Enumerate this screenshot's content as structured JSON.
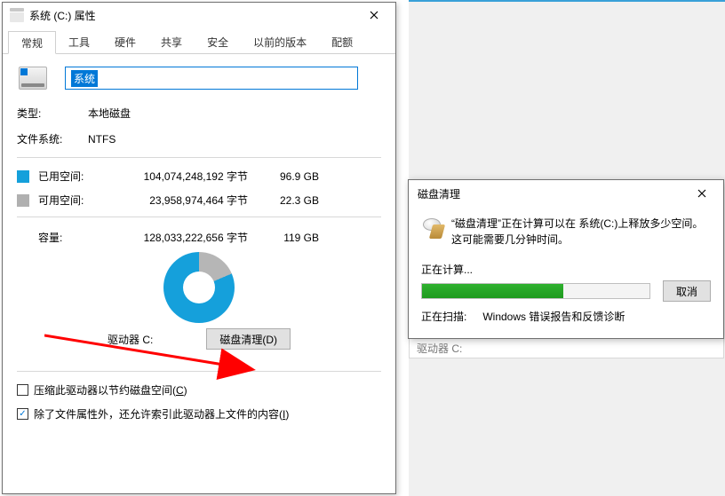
{
  "props_window": {
    "title": "系统 (C:) 属性",
    "tabs": [
      "常规",
      "工具",
      "硬件",
      "共享",
      "安全",
      "以前的版本",
      "配额"
    ],
    "active_tab": 0,
    "drive_name": "系统",
    "type_label": "类型:",
    "type_value": "本地磁盘",
    "fs_label": "文件系统:",
    "fs_value": "NTFS",
    "used_label": "已用空间:",
    "used_bytes": "104,074,248,192 字节",
    "used_human": "96.9 GB",
    "free_label": "可用空间:",
    "free_bytes": "23,958,974,464 字节",
    "free_human": "22.3 GB",
    "capacity_label": "容量:",
    "capacity_bytes": "128,033,222,656 字节",
    "capacity_human": "119 GB",
    "drive_label": "驱动器 C:",
    "clean_button": "磁盘清理(D)",
    "compress_label_1": "压缩此驱动器以节约磁盘空间(",
    "compress_hot": "C",
    "compress_label_2": ")",
    "index_label_1": "除了文件属性外，还允许索引此驱动器上文件的内容(",
    "index_hot": "I",
    "index_label_2": ")",
    "compress_checked": false,
    "index_checked": true
  },
  "ghost_row": "驱动器 C:",
  "chart_data": {
    "type": "pie",
    "title": "驱动器 C:",
    "series": [
      {
        "name": "已用空间",
        "value_bytes": 104074248192,
        "value_human": "96.9 GB",
        "color": "#15a0db"
      },
      {
        "name": "可用空间",
        "value_bytes": 23958974464,
        "value_human": "22.3 GB",
        "color": "#b6b6b6"
      }
    ],
    "total_bytes": 128033222656,
    "total_human": "119 GB"
  },
  "clean_dialog": {
    "title": "磁盘清理",
    "message": "“磁盘清理”正在计算可以在 系统(C:)上释放多少空间。这可能需要几分钟时间。",
    "calculating": "正在计算...",
    "cancel": "取消",
    "scanning_label": "正在扫描:",
    "scanning_item": "Windows 错误报告和反馈诊断",
    "progress_percent": 62
  }
}
